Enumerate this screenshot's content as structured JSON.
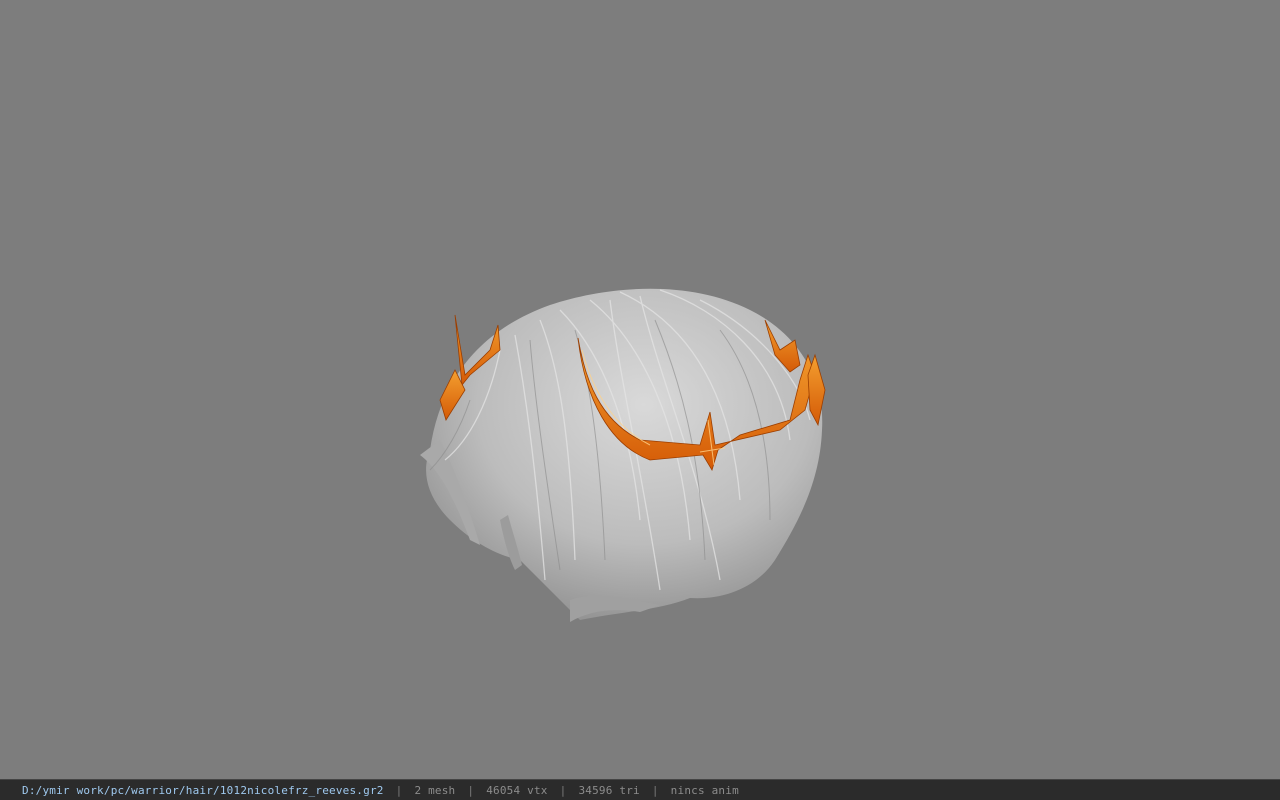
{
  "viewer": {
    "background_color": "#7d7d7d",
    "model": {
      "description_icon": "hair-mesh-with-crown",
      "hair_color": "#bdbdbd",
      "crown_color": "#e8700e"
    }
  },
  "statusbar": {
    "file_path": "D:/ymir work/pc/warrior/hair/1012nicolefrz_reeves.gr2",
    "separator": "|",
    "mesh": "2 mesh",
    "vertices": "46054 vtx",
    "triangles": "34596 tri",
    "anim": "nincs anim"
  }
}
